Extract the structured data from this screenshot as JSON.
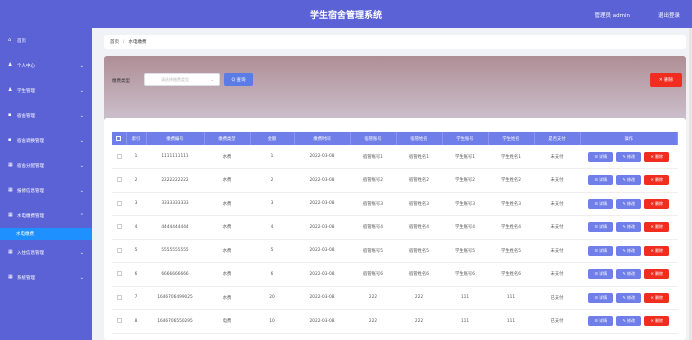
{
  "header": {
    "title": "学生宿舍管理系统",
    "user": "管理员 admin",
    "logout": "退出登录"
  },
  "sidebar": {
    "items": [
      {
        "label": "首页",
        "icon": "⌂",
        "chev": ""
      },
      {
        "label": "个人中心",
        "icon": "♟",
        "chev": "⌄"
      },
      {
        "label": "学生管理",
        "icon": "♟",
        "chev": "⌄"
      },
      {
        "label": "宿舍管理",
        "icon": "▪",
        "chev": "⌄"
      },
      {
        "label": "宿舍调换管理",
        "icon": "▪",
        "chev": "⌄"
      },
      {
        "label": "宿舍分配管理",
        "icon": "▦",
        "chev": "⌄"
      },
      {
        "label": "报修信息管理",
        "icon": "▦",
        "chev": "⌄"
      },
      {
        "label": "水电缴费管理",
        "icon": "▦",
        "chev": "⌃"
      }
    ],
    "sub_active": "水电缴费",
    "items2": [
      {
        "label": "入住信息管理",
        "icon": "▦",
        "chev": "⌄"
      },
      {
        "label": "系统管理",
        "icon": "▦",
        "chev": "⌄"
      }
    ]
  },
  "breadcrumb": {
    "home": "首页",
    "sep": "/",
    "current": "水电缴费"
  },
  "search": {
    "label": "缴费类型",
    "placeholder": "请选择缴费类型",
    "arrow": "⌄",
    "button": "Q 查询",
    "delete": "✕ 删除"
  },
  "table": {
    "headers": [
      "索引",
      "缴费编号",
      "缴费类型",
      "金额",
      "缴费时间",
      "宿管账号",
      "宿管姓名",
      "学生账号",
      "学生姓名",
      "是否支付",
      "操作"
    ],
    "ops": {
      "view": "☰ 详情",
      "edit": "✎ 修改",
      "del": "✕ 删除"
    },
    "rows": [
      [
        "1",
        "1111111111",
        "水费",
        "1",
        "2022-03-08",
        "宿管账号1",
        "宿管姓名1",
        "学生账号1",
        "学生姓名1",
        "未支付"
      ],
      [
        "2",
        "2222222222",
        "水费",
        "2",
        "2022-03-08",
        "宿管账号2",
        "宿管姓名2",
        "学生账号2",
        "学生姓名2",
        "未支付"
      ],
      [
        "3",
        "3333333333",
        "水费",
        "3",
        "2022-03-08",
        "宿管账号3",
        "宿管姓名3",
        "学生账号3",
        "学生姓名3",
        "未支付"
      ],
      [
        "4",
        "4444444444",
        "水费",
        "4",
        "2022-03-08",
        "宿管账号4",
        "宿管姓名4",
        "学生账号4",
        "学生姓名4",
        "未支付"
      ],
      [
        "5",
        "5555555555",
        "水费",
        "5",
        "2022-03-08",
        "宿管账号5",
        "宿管姓名5",
        "学生账号5",
        "学生姓名5",
        "未支付"
      ],
      [
        "6",
        "6666666666",
        "水费",
        "6",
        "2022-03-08",
        "宿管账号6",
        "宿管姓名6",
        "学生账号6",
        "学生姓名6",
        "未支付"
      ],
      [
        "7",
        "1646706499025",
        "水费",
        "20",
        "2022-03-08",
        "222",
        "222",
        "111",
        "111",
        "已支付"
      ],
      [
        "8",
        "1646706550295",
        "电费",
        "10",
        "2022-03-08",
        "222",
        "222",
        "111",
        "111",
        "已支付"
      ]
    ]
  },
  "colors": {
    "primary": "#5b62d6",
    "danger": "#f02d1f",
    "accent": "#1e90ff"
  }
}
